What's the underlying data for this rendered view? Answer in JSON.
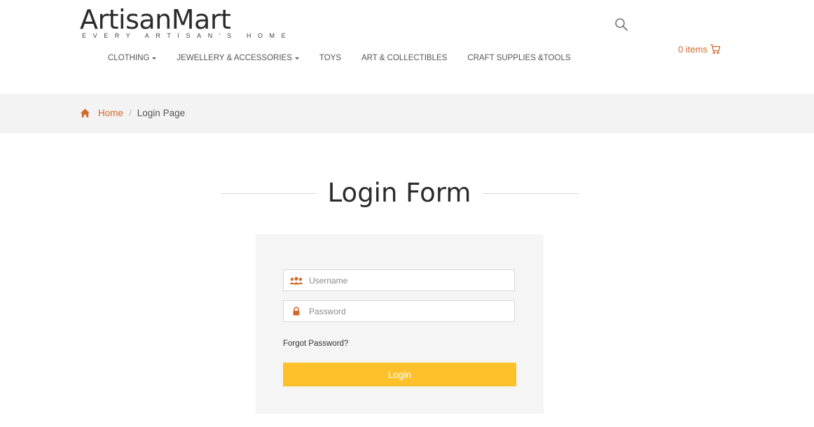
{
  "brand": {
    "name": "ArtisanMart",
    "tagline": "EVERY ARTISAN'S HOME"
  },
  "nav": {
    "items": [
      {
        "label": "CLOTHING",
        "dropdown": true
      },
      {
        "label": "JEWELLERY & ACCESSORIES",
        "dropdown": true
      },
      {
        "label": "TOYS",
        "dropdown": false
      },
      {
        "label": "ART & COLLECTIBLES",
        "dropdown": false
      },
      {
        "label": "CRAFT SUPPLIES &TOOLS",
        "dropdown": false
      }
    ]
  },
  "header": {
    "search_icon": "search-icon",
    "cart_label": "0 items",
    "cart_icon": "cart-icon"
  },
  "breadcrumb": {
    "home_icon": "home-icon",
    "home": "Home",
    "separator": "/",
    "current": "Login Page"
  },
  "login": {
    "title": "Login Form",
    "username_placeholder": "Username",
    "username_value": "",
    "password_placeholder": "Password",
    "password_value": "",
    "forgot": "Forgot Password?",
    "button": "Login"
  },
  "colors": {
    "accent": "#d2692a",
    "button": "#fec12b",
    "breadcrumb_bg": "#f3f3f3",
    "panel_bg": "#f5f5f6"
  }
}
